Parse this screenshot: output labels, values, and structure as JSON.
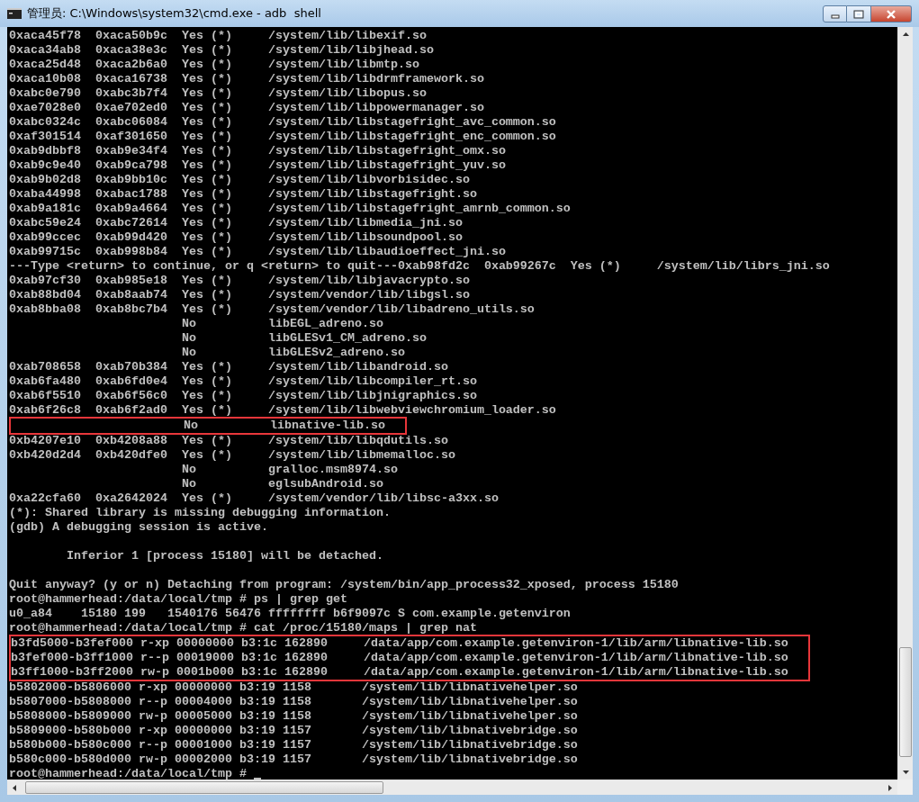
{
  "window": {
    "title": "管理员: C:\\Windows\\system32\\cmd.exe - adb  shell"
  },
  "console": {
    "lines": [
      {
        "kind": "text",
        "text": "0xaca45f78  0xaca50b9c  Yes (*)     /system/lib/libexif.so"
      },
      {
        "kind": "text",
        "text": "0xaca34ab8  0xaca38e3c  Yes (*)     /system/lib/libjhead.so"
      },
      {
        "kind": "text",
        "text": "0xaca25d48  0xaca2b6a0  Yes (*)     /system/lib/libmtp.so"
      },
      {
        "kind": "text",
        "text": "0xaca10b08  0xaca16738  Yes (*)     /system/lib/libdrmframework.so"
      },
      {
        "kind": "text",
        "text": "0xabc0e790  0xabc3b7f4  Yes (*)     /system/lib/libopus.so"
      },
      {
        "kind": "text",
        "text": "0xae7028e0  0xae702ed0  Yes (*)     /system/lib/libpowermanager.so"
      },
      {
        "kind": "text",
        "text": "0xabc0324c  0xabc06084  Yes (*)     /system/lib/libstagefright_avc_common.so"
      },
      {
        "kind": "text",
        "text": "0xaf301514  0xaf301650  Yes (*)     /system/lib/libstagefright_enc_common.so"
      },
      {
        "kind": "text",
        "text": "0xab9dbbf8  0xab9e34f4  Yes (*)     /system/lib/libstagefright_omx.so"
      },
      {
        "kind": "text",
        "text": "0xab9c9e40  0xab9ca798  Yes (*)     /system/lib/libstagefright_yuv.so"
      },
      {
        "kind": "text",
        "text": "0xab9b02d8  0xab9bb10c  Yes (*)     /system/lib/libvorbisidec.so"
      },
      {
        "kind": "text",
        "text": "0xaba44998  0xabac1788  Yes (*)     /system/lib/libstagefright.so"
      },
      {
        "kind": "text",
        "text": "0xab9a181c  0xab9a4664  Yes (*)     /system/lib/libstagefright_amrnb_common.so"
      },
      {
        "kind": "text",
        "text": "0xabc59e24  0xabc72614  Yes (*)     /system/lib/libmedia_jni.so"
      },
      {
        "kind": "text",
        "text": "0xab99ccec  0xab99d420  Yes (*)     /system/lib/libsoundpool.so"
      },
      {
        "kind": "text",
        "text": "0xab99715c  0xab998b84  Yes (*)     /system/lib/libaudioeffect_jni.so"
      },
      {
        "kind": "text",
        "text": "---Type <return> to continue, or q <return> to quit---0xab98fd2c  0xab99267c  Yes (*)     /system/lib/librs_jni.so"
      },
      {
        "kind": "text",
        "text": "0xab97cf30  0xab985e18  Yes (*)     /system/lib/libjavacrypto.so"
      },
      {
        "kind": "text",
        "text": "0xab88bd04  0xab8aab74  Yes (*)     /system/vendor/lib/libgsl.so"
      },
      {
        "kind": "text",
        "text": "0xab8bba08  0xab8bc7b4  Yes (*)     /system/vendor/lib/libadreno_utils.so"
      },
      {
        "kind": "text",
        "text": "                        No          libEGL_adreno.so"
      },
      {
        "kind": "text",
        "text": "                        No          libGLESv1_CM_adreno.so"
      },
      {
        "kind": "text",
        "text": "                        No          libGLESv2_adreno.so"
      },
      {
        "kind": "text",
        "text": "0xab708658  0xab70b384  Yes (*)     /system/lib/libandroid.so"
      },
      {
        "kind": "text",
        "text": "0xab6fa480  0xab6fd0e4  Yes (*)     /system/lib/libcompiler_rt.so"
      },
      {
        "kind": "text",
        "text": "0xab6f5510  0xab6f56c0  Yes (*)     /system/lib/libjnigraphics.so"
      },
      {
        "kind": "text",
        "text": "0xab6f26c8  0xab6f2ad0  Yes (*)     /system/lib/libwebviewchromium_loader.so"
      },
      {
        "kind": "highlight",
        "lines": [
          "                        No          libnative-lib.so"
        ]
      },
      {
        "kind": "text",
        "text": "0xb4207e10  0xb4208a88  Yes (*)     /system/lib/libqdutils.so"
      },
      {
        "kind": "text",
        "text": "0xb420d2d4  0xb420dfe0  Yes (*)     /system/lib/libmemalloc.so"
      },
      {
        "kind": "text",
        "text": "                        No          gralloc.msm8974.so"
      },
      {
        "kind": "text",
        "text": "                        No          eglsubAndroid.so"
      },
      {
        "kind": "text",
        "text": "0xa22cfa60  0xa2642024  Yes (*)     /system/vendor/lib/libsc-a3xx.so"
      },
      {
        "kind": "text",
        "text": "(*): Shared library is missing debugging information."
      },
      {
        "kind": "text",
        "text": "(gdb) A debugging session is active."
      },
      {
        "kind": "blank"
      },
      {
        "kind": "text",
        "text": "        Inferior 1 [process 15180] will be detached."
      },
      {
        "kind": "blank"
      },
      {
        "kind": "text",
        "text": "Quit anyway? (y or n) Detaching from program: /system/bin/app_process32_xposed, process 15180"
      },
      {
        "kind": "text",
        "text": "root@hammerhead:/data/local/tmp # ps | grep get"
      },
      {
        "kind": "text",
        "text": "u0_a84    15180 199   1540176 56476 ffffffff b6f9097c S com.example.getenviron"
      },
      {
        "kind": "text",
        "text": "root@hammerhead:/data/local/tmp # cat /proc/15180/maps | grep nat"
      },
      {
        "kind": "highlight",
        "lines": [
          "b3fd5000-b3fef000 r-xp 00000000 b3:1c 162890     /data/app/com.example.getenviron-1/lib/arm/libnative-lib.so",
          "b3fef000-b3ff1000 r--p 00019000 b3:1c 162890     /data/app/com.example.getenviron-1/lib/arm/libnative-lib.so",
          "b3ff1000-b3ff2000 rw-p 0001b000 b3:1c 162890     /data/app/com.example.getenviron-1/lib/arm/libnative-lib.so"
        ]
      },
      {
        "kind": "text",
        "text": "b5802000-b5806000 r-xp 00000000 b3:19 1158       /system/lib/libnativehelper.so"
      },
      {
        "kind": "text",
        "text": "b5807000-b5808000 r--p 00004000 b3:19 1158       /system/lib/libnativehelper.so"
      },
      {
        "kind": "text",
        "text": "b5808000-b5809000 rw-p 00005000 b3:19 1158       /system/lib/libnativehelper.so"
      },
      {
        "kind": "text",
        "text": "b5809000-b580b000 r-xp 00000000 b3:19 1157       /system/lib/libnativebridge.so"
      },
      {
        "kind": "text",
        "text": "b580b000-b580c000 r--p 00001000 b3:19 1157       /system/lib/libnativebridge.so"
      },
      {
        "kind": "text",
        "text": "b580c000-b580d000 rw-p 00002000 b3:19 1157       /system/lib/libnativebridge.so"
      },
      {
        "kind": "prompt",
        "text": "root@hammerhead:/data/local/tmp # "
      }
    ]
  }
}
